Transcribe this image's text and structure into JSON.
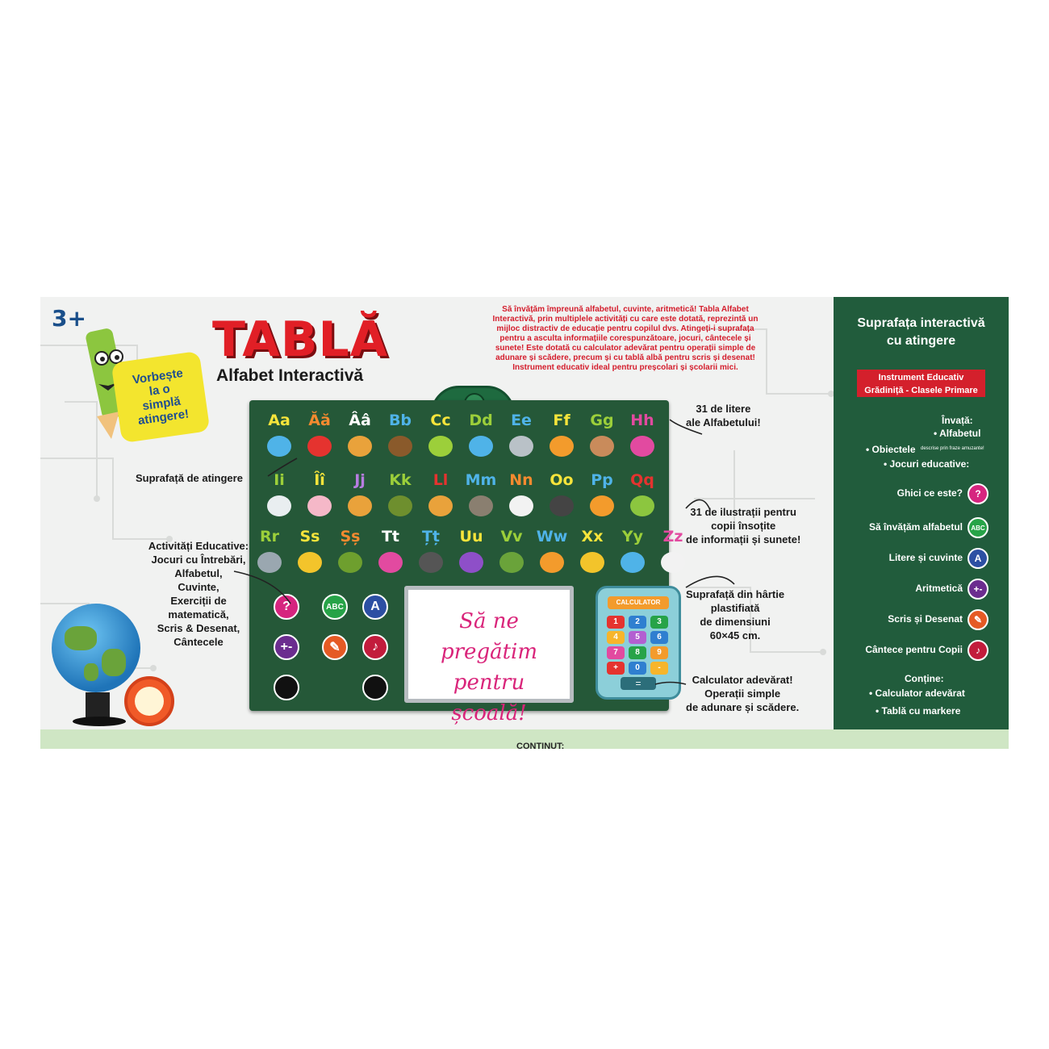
{
  "age_badge": "3+",
  "speech_bubble": "Vorbește\nla o\nsimplă\natingere!",
  "title": "TABLĂ",
  "subtitle": "Alfabet Interactivă",
  "description": "Să învățăm împreună alfabetul, cuvinte, aritmetică! Tabla Alfabet Interactivă, prin multiplele activități cu care este dotată, reprezintă un mijloc distractiv de educație pentru copilul dvs. Atingeți-i suprafața pentru a asculta informațiile corespunzătoare, jocuri, cântecele și sunete! Este dotată cu calculator adevărat pentru operații simple de adunare și scădere, precum și cu tablă albă pentru scris și desenat! Instrument educativ ideal pentru preșcolari și școlarii mici.",
  "letters": {
    "row1": [
      "Aa",
      "Ăă",
      "Ââ",
      "Bb",
      "Cc",
      "Dd",
      "Ee",
      "Ff",
      "Gg",
      "Hh"
    ],
    "row2": [
      "Ii",
      "Îî",
      "Jj",
      "Kk",
      "Ll",
      "Mm",
      "Nn",
      "Oo",
      "Pp",
      "Qq"
    ],
    "row3": [
      "Rr",
      "Ss",
      "Șș",
      "Tt",
      "Țț",
      "Uu",
      "Vv",
      "Ww",
      "Xx",
      "Yy",
      "Zz"
    ]
  },
  "letter_colors": [
    "#f7e43b",
    "#f58a2f",
    "#ffffff",
    "#4fb3e8",
    "#f7e43b",
    "#9ccf3a",
    "#4fb3e8",
    "#f7e43b",
    "#9ccf3a",
    "#e24aa0",
    "#9ccf3a",
    "#f7e43b",
    "#b77de0",
    "#9ccf3a",
    "#e5332f",
    "#4fb3e8",
    "#f58a2f",
    "#f7e43b",
    "#4fb3e8",
    "#e5332f",
    "#9ccf3a"
  ],
  "activity_icons": [
    {
      "name": "question-icon",
      "symbol": "?",
      "color": "#d6257f"
    },
    {
      "name": "abc-icon",
      "symbol": "ABC",
      "color": "#27a348"
    },
    {
      "name": "letter-a-icon",
      "symbol": "A",
      "color": "#2c4fa3"
    },
    {
      "name": "plus-minus-icon",
      "symbol": "+-",
      "color": "#6b2d8f"
    },
    {
      "name": "pencil-icon",
      "symbol": "✎",
      "color": "#e55a24"
    },
    {
      "name": "music-note-icon",
      "symbol": "♪",
      "color": "#c21c3c"
    }
  ],
  "whiteboard_text": "Să ne pregătim\npentru școală!",
  "calculator": {
    "title": "CALCULATOR",
    "keys": [
      "1",
      "2",
      "3",
      "4",
      "5",
      "6",
      "7",
      "8",
      "9",
      "+",
      "0",
      "-"
    ],
    "key_colors": [
      "#e5332f",
      "#2f7fd0",
      "#27a348",
      "#f7b52b",
      "#b35fd1",
      "#2f7fd0",
      "#e24aa0",
      "#27a348",
      "#f39b2c",
      "#e5332f",
      "#2f7fd0",
      "#f7b52b"
    ],
    "equals": "="
  },
  "callouts": {
    "touch_surface": "Suprafață de atingere",
    "activities": "Activități Educative:\nJocuri cu Întrebări,\nAlfabetul,\nCuvinte,\nExerciții de\nmatematică,\nScris & Desenat,\nCântecele",
    "letters31": "31 de litere\nale Alfabetului!",
    "illustrations31": "31 de ilustrații pentru\ncopii însoțite\nde informații și sunete!",
    "paper_surface": "Suprafață din hârtie\nplastifiată\nde dimensiuni\n60×45 cm.",
    "calculator": "Calculator adevărat!\nOperații simple\nde adunare și scădere."
  },
  "side_panel": {
    "title": "Suprafața interactivă\ncu atingere",
    "badge": "Instrument Educativ\nGrădiniță - Clasele Primare",
    "learn_heading": "Învață:",
    "learn_items": [
      "• Alfabetul",
      "• Obiectele",
      "descrise prin fraze amuzante!",
      "• Jocuri educative:"
    ],
    "modes": [
      {
        "label": "Ghici ce este?",
        "icon": "?",
        "color": "#d6257f"
      },
      {
        "label": "Să învățăm alfabetul",
        "icon": "ABC",
        "color": "#27a348"
      },
      {
        "label": "Litere și cuvinte",
        "icon": "A",
        "color": "#2c4fa3"
      },
      {
        "label": "Aritmetică",
        "icon": "+-",
        "color": "#6b2d8f"
      },
      {
        "label": "Scris și Desenat",
        "icon": "✎",
        "color": "#e55a24"
      },
      {
        "label": "Cântece pentru Copii",
        "icon": "♪",
        "color": "#c21c3c"
      }
    ],
    "contains_heading": "Conține:",
    "contains_items": [
      "• Calculator adevărat",
      "• Tablă cu markere"
    ]
  },
  "bottom_label": "CONTINUT:",
  "colors": {
    "board": "#255838",
    "side": "#215c3c",
    "title": "#e11f26",
    "accent": "#1f4e90"
  }
}
